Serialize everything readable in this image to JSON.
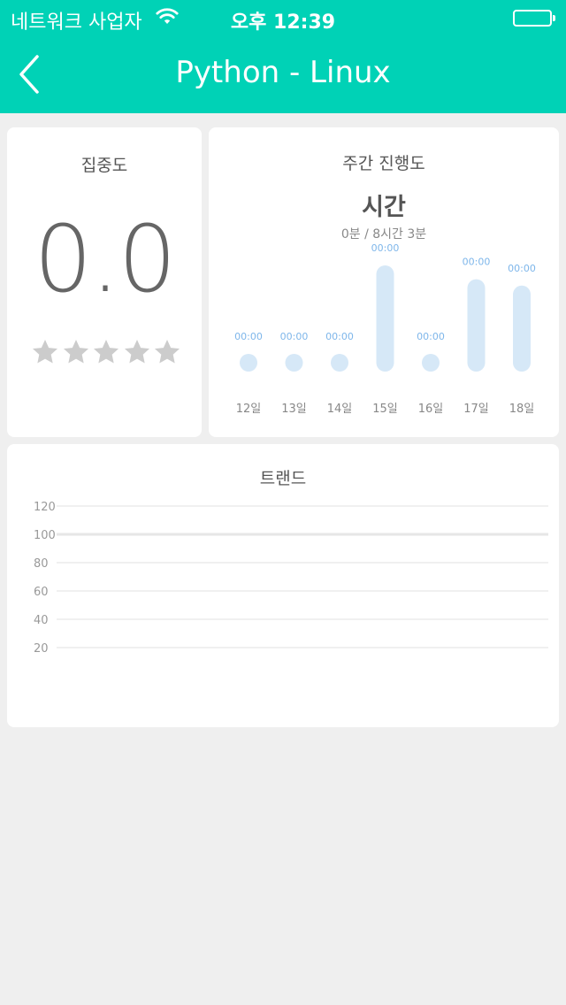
{
  "status_bar": {
    "carrier": "네트워크 사업자",
    "time": "오후 12:39"
  },
  "nav": {
    "title": "Python - Linux",
    "back_icon": "chevron-left-icon"
  },
  "focus": {
    "title": "집중도",
    "score": "0.0",
    "stars_total": 5,
    "stars_filled": 0,
    "star_color": "#cccccc"
  },
  "weekly": {
    "title": "주간 진행도",
    "unit": "시간",
    "summary": "0분 / 8시간 3분",
    "bar_color": "#d6e8f7",
    "label_color": "#7eb6ea"
  },
  "trend": {
    "title": "트랜드"
  },
  "colors": {
    "accent": "#00d2b6",
    "background": "#efefef",
    "card": "#ffffff"
  },
  "chart_data": [
    {
      "type": "bar",
      "categories": [
        "12일",
        "13일",
        "14일",
        "15일",
        "16일",
        "17일",
        "18일"
      ],
      "value_labels": [
        "00:00",
        "00:00",
        "00:00",
        "00:00",
        "00:00",
        "00:00",
        "00:00"
      ],
      "values": [
        0,
        0,
        0,
        100,
        0,
        87,
        81
      ],
      "ylim": [
        0,
        100
      ]
    },
    {
      "type": "line",
      "title": "트랜드",
      "yticks": [
        120,
        100,
        80,
        60,
        40,
        20
      ],
      "series": [],
      "grid": true
    }
  ]
}
